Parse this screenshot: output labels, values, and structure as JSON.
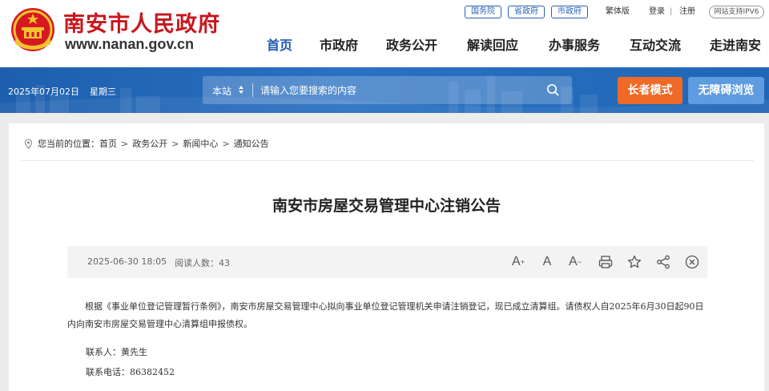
{
  "header": {
    "site_title": "南安市人民政府",
    "site_url": "www.nanan.gov.cn",
    "top_links": [
      "国务院",
      "省政府",
      "市政府"
    ],
    "traditional": "繁体版",
    "login": "登录",
    "register": "注册",
    "ipv6": "网站支持IPV6",
    "nav": [
      "首页",
      "市政府",
      "政务公开",
      "解读回应",
      "办事服务",
      "互动交流",
      "走进南安"
    ],
    "active_nav": "首页"
  },
  "banner": {
    "date": "2025年07月02日",
    "weekday": "星期三",
    "search_scope": "本站",
    "search_placeholder": "请输入您要搜索的内容",
    "elder_mode": "长者模式",
    "accessible": "无障碍浏览"
  },
  "breadcrumb": {
    "prefix": "您当前的位置：",
    "items": [
      "首页",
      "政务公开",
      "新闻中心",
      "通知公告"
    ],
    "separator": ">"
  },
  "article": {
    "title": "南安市房屋交易管理中心注销公告",
    "datetime": "2025-06-30 18:05",
    "reads_label": "阅读人数：",
    "reads": "43",
    "body": "根据《事业单位登记管理暂行条例》，南安市房屋交易管理中心拟向事业单位登记管理机关申请注销登记，现已成立清算组。请债权人自2025年6月30日起90日内向南安市房屋交易管理中心清算组申报债权。",
    "contact": "联系人：黄先生",
    "phone": "联系电话：86382452"
  },
  "tools": {
    "font_larger": "A",
    "font_normal": "A",
    "font_smaller": "A"
  },
  "icons": [
    "emblem-icon",
    "location-pin-icon",
    "search-icon",
    "chevron-updown-icon",
    "print-icon",
    "star-icon",
    "share-icon",
    "close-circle-icon"
  ],
  "colors": {
    "brand_red": "#c8161d",
    "nav_active": "#1d58b0",
    "banner_blue": "#2a71c2",
    "elder_orange": "#ee6a26",
    "access_blue": "#5e9be0"
  }
}
